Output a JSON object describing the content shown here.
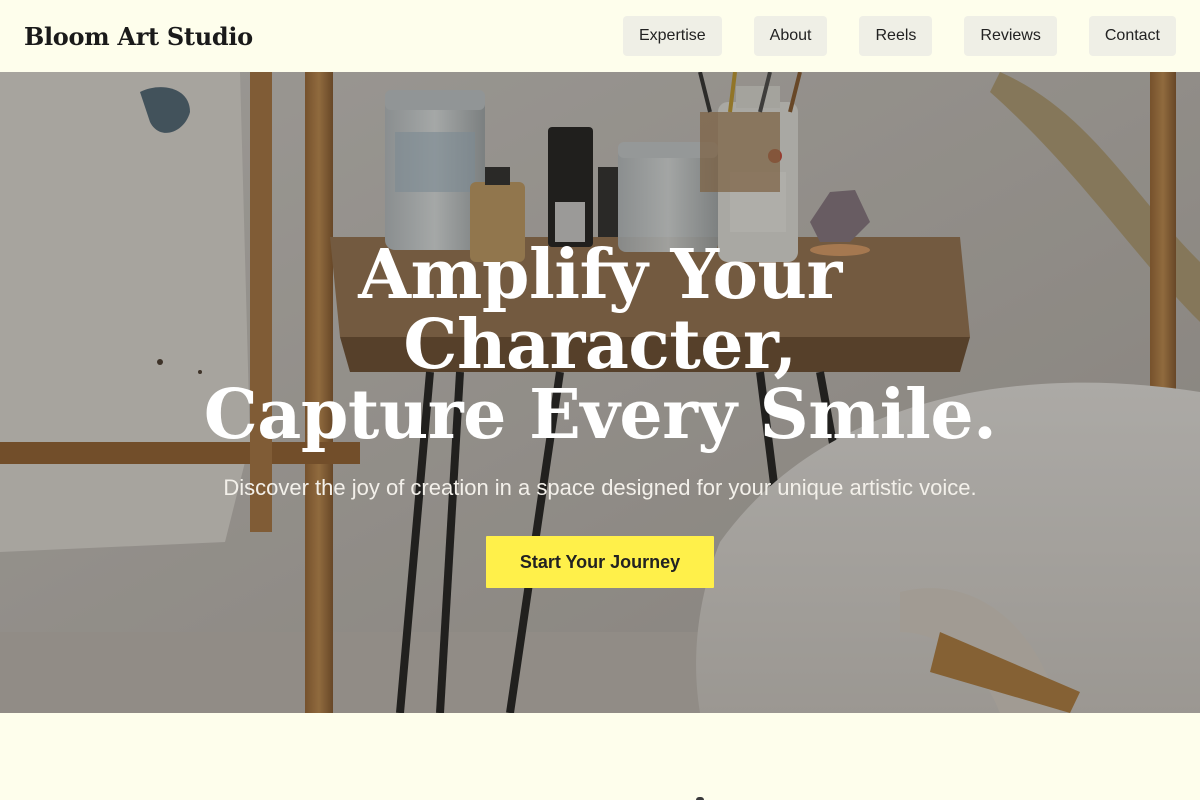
{
  "header": {
    "brand": "Bloom Art Studio",
    "nav": [
      {
        "label": "Expertise"
      },
      {
        "label": "About"
      },
      {
        "label": "Reels"
      },
      {
        "label": "Reviews"
      },
      {
        "label": "Contact"
      }
    ]
  },
  "hero": {
    "headline_line1": "Amplify Your Character,",
    "headline_line2": "Capture Every Smile.",
    "subtext": "Discover the joy of creation in a space designed for your unique artistic voice.",
    "cta_label": "Start Your Journey"
  },
  "colors": {
    "page_background": "#FEFEEC",
    "nav_button_background": "#EFEFE6",
    "cta_background": "#FFF04A",
    "headline_color": "#FFFFFF"
  }
}
